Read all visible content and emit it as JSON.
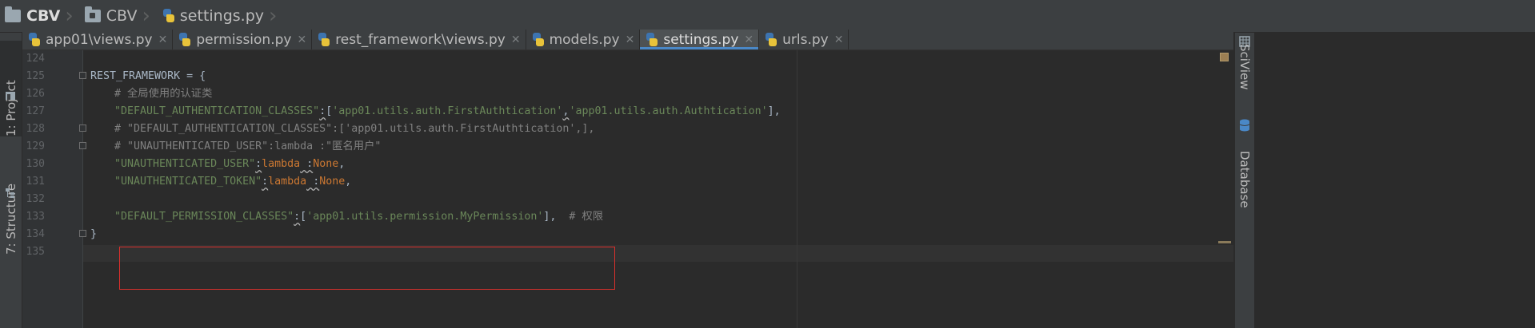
{
  "breadcrumb": [
    {
      "label": "CBV",
      "icon": "folder-icon"
    },
    {
      "label": "CBV",
      "icon": "module-folder-icon"
    },
    {
      "label": "settings.py",
      "icon": "python-file-icon"
    }
  ],
  "left_tool_tabs": [
    {
      "label": "1: Project",
      "icon": "project-icon"
    },
    {
      "label": "7: Structure",
      "icon": "structure-icon"
    }
  ],
  "right_tool_tabs": [
    {
      "label": "SciView",
      "icon": "sciview-icon"
    },
    {
      "label": "Database",
      "icon": "database-icon"
    }
  ],
  "editor_tabs": [
    {
      "label": "app01\\views.py",
      "active": false
    },
    {
      "label": "permission.py",
      "active": false
    },
    {
      "label": "rest_framework\\views.py",
      "active": false
    },
    {
      "label": "models.py",
      "active": false
    },
    {
      "label": "settings.py",
      "active": true
    },
    {
      "label": "urls.py",
      "active": false
    }
  ],
  "tab_close_glyph": "✕",
  "line_numbers": [
    "124",
    "125",
    "126",
    "127",
    "128",
    "129",
    "130",
    "131",
    "132",
    "133",
    "134",
    "135"
  ],
  "code": {
    "l125": "REST_FRAMEWORK = {",
    "l126": "# 全局使用的认证类",
    "l127_key": "\"DEFAULT_AUTHENTICATION_CLASSES\"",
    "l127_v1": "'app01.utils.auth.FirstAuthtication'",
    "l127_v2": "'app01.utils.auth.Authtication'",
    "l128": "# \"DEFAULT_AUTHENTICATION_CLASSES\":['app01.utils.auth.FirstAuthtication',],",
    "l129": "# \"UNAUTHENTICATED_USER\":lambda :\"匿名用户\"",
    "l130_key": "\"UNAUTHENTICATED_USER\"",
    "l130_lambda": "lambda",
    "l130_none": "None",
    "l131_key": "\"UNAUTHENTICATED_TOKEN\"",
    "l131_lambda": "lambda",
    "l131_none": "None",
    "l133_key": "\"DEFAULT_PERMISSION_CLASSES\"",
    "l133_v": "'app01.utils.permission.MyPermission'",
    "l133_cmt": "# 权限",
    "l134": "}"
  },
  "colors": {
    "accent": "#4a88c7",
    "highlight_box": "#d9302c",
    "string": "#6a8759",
    "keyword": "#cc7832",
    "comment": "#808080"
  }
}
